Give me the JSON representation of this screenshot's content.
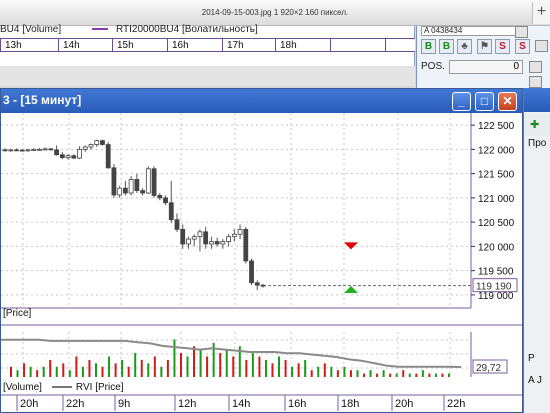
{
  "viewer": {
    "caption": "2014-09-15-003.jpg 1 920×2 160 пиксел.",
    "plus_icon": "plus-icon"
  },
  "bg_chart": {
    "legend_1": "BU4 [Volume]",
    "legend_2": "RTI20000BU4 [Волатильность]",
    "hours": [
      "13h",
      "14h",
      "15h",
      "16h",
      "17h",
      "18h"
    ]
  },
  "trade_panel": {
    "field_value": "A 0438434",
    "buttons": [
      "B",
      "B",
      "S",
      "S"
    ],
    "pos_label": "POS.",
    "pos_value": "0"
  },
  "main_window": {
    "title": "3 - [15 минут]",
    "price_label": "[Price]",
    "bottom_legend_1": "[Volume]",
    "bottom_legend_2": "RVI [Price]"
  },
  "side_window": {
    "text_1": "Про",
    "text_2": "P",
    "text_3": "A  J"
  },
  "chart_data": [
    {
      "type": "candlestick",
      "title": "",
      "y_ticks": [
        "122 500",
        "122 000",
        "121 500",
        "121 000",
        "120 500",
        "120 000",
        "119 500",
        "119 000"
      ],
      "ylim": [
        118750,
        122750
      ],
      "last_price_label": "119 190",
      "last_price": 119190,
      "candles": [
        {
          "o": 121990,
          "h": 122020,
          "l": 121960,
          "c": 121980
        },
        {
          "o": 121980,
          "h": 122010,
          "l": 121950,
          "c": 121990
        },
        {
          "o": 121990,
          "h": 122020,
          "l": 121970,
          "c": 121985
        },
        {
          "o": 121985,
          "h": 122000,
          "l": 121960,
          "c": 121975
        },
        {
          "o": 121975,
          "h": 122010,
          "l": 121950,
          "c": 121990
        },
        {
          "o": 121990,
          "h": 122020,
          "l": 121970,
          "c": 121995
        },
        {
          "o": 121995,
          "h": 122030,
          "l": 121980,
          "c": 122000
        },
        {
          "o": 122000,
          "h": 122040,
          "l": 121980,
          "c": 122010
        },
        {
          "o": 122010,
          "h": 122030,
          "l": 121980,
          "c": 121990
        },
        {
          "o": 121990,
          "h": 122080,
          "l": 121870,
          "c": 121890
        },
        {
          "o": 121890,
          "h": 121950,
          "l": 121800,
          "c": 121830
        },
        {
          "o": 121830,
          "h": 121900,
          "l": 121790,
          "c": 121870
        },
        {
          "o": 121870,
          "h": 121900,
          "l": 121800,
          "c": 121820
        },
        {
          "o": 121820,
          "h": 122060,
          "l": 121800,
          "c": 122000
        },
        {
          "o": 122000,
          "h": 122080,
          "l": 121950,
          "c": 122050
        },
        {
          "o": 122050,
          "h": 122120,
          "l": 121990,
          "c": 122100
        },
        {
          "o": 122100,
          "h": 122200,
          "l": 122050,
          "c": 122180
        },
        {
          "o": 122180,
          "h": 122200,
          "l": 122080,
          "c": 122100
        },
        {
          "o": 122100,
          "h": 122150,
          "l": 121600,
          "c": 121620
        },
        {
          "o": 121620,
          "h": 121700,
          "l": 121000,
          "c": 121060
        },
        {
          "o": 121060,
          "h": 121250,
          "l": 121000,
          "c": 121200
        },
        {
          "o": 121200,
          "h": 121350,
          "l": 121050,
          "c": 121100
        },
        {
          "o": 121100,
          "h": 121450,
          "l": 121050,
          "c": 121380
        },
        {
          "o": 121380,
          "h": 121500,
          "l": 121100,
          "c": 121150
        },
        {
          "o": 121150,
          "h": 121200,
          "l": 121050,
          "c": 121100
        },
        {
          "o": 121100,
          "h": 121650,
          "l": 121080,
          "c": 121600
        },
        {
          "o": 121600,
          "h": 121650,
          "l": 121000,
          "c": 121050
        },
        {
          "o": 121050,
          "h": 121100,
          "l": 120950,
          "c": 121000
        },
        {
          "o": 121000,
          "h": 121050,
          "l": 120850,
          "c": 120900
        },
        {
          "o": 120900,
          "h": 121350,
          "l": 120480,
          "c": 120550
        },
        {
          "o": 120550,
          "h": 120680,
          "l": 120300,
          "c": 120350
        },
        {
          "o": 120350,
          "h": 120450,
          "l": 119950,
          "c": 120050
        },
        {
          "o": 120050,
          "h": 120200,
          "l": 119950,
          "c": 120150
        },
        {
          "o": 120150,
          "h": 120250,
          "l": 120000,
          "c": 120200
        },
        {
          "o": 120200,
          "h": 120350,
          "l": 119900,
          "c": 120300
        },
        {
          "o": 120300,
          "h": 120400,
          "l": 119950,
          "c": 120050
        },
        {
          "o": 120050,
          "h": 120200,
          "l": 119950,
          "c": 120100
        },
        {
          "o": 120100,
          "h": 120180,
          "l": 120000,
          "c": 120050
        },
        {
          "o": 120050,
          "h": 120150,
          "l": 119950,
          "c": 120100
        },
        {
          "o": 120100,
          "h": 120250,
          "l": 120000,
          "c": 120200
        },
        {
          "o": 120200,
          "h": 120350,
          "l": 120100,
          "c": 120250
        },
        {
          "o": 120250,
          "h": 120450,
          "l": 120150,
          "c": 120350
        },
        {
          "o": 120350,
          "h": 120400,
          "l": 119650,
          "c": 119700
        },
        {
          "o": 119700,
          "h": 119750,
          "l": 119200,
          "c": 119250
        },
        {
          "o": 119250,
          "h": 119300,
          "l": 119100,
          "c": 119200
        },
        {
          "o": 119200,
          "h": 119230,
          "l": 119150,
          "c": 119190
        }
      ],
      "markers": [
        {
          "kind": "sell-arrow",
          "y": 120000,
          "color": "#dd0000"
        },
        {
          "kind": "buy-arrow",
          "y": 119120,
          "color": "#1fb41f"
        }
      ]
    },
    {
      "type": "bar",
      "title": "",
      "rvi_label": "29,72",
      "x_ticks": [
        "20h",
        "22h",
        "9h",
        "12h",
        "14h",
        "16h",
        "18h",
        "20h",
        "22h"
      ],
      "volume": [
        3,
        2,
        4,
        3,
        2,
        3,
        5,
        3,
        4,
        2,
        6,
        3,
        5,
        4,
        3,
        6,
        4,
        5,
        3,
        7,
        5,
        4,
        6,
        3,
        5,
        11,
        7,
        6,
        9,
        8,
        6,
        10,
        7,
        8,
        6,
        9,
        5,
        7,
        6,
        5,
        4,
        6,
        5,
        3,
        4,
        5,
        2,
        3,
        4,
        3,
        2,
        3,
        2,
        2,
        1,
        2,
        1,
        2,
        1,
        1,
        2,
        1,
        1,
        2,
        1,
        1,
        1,
        1
      ],
      "volume_colors": [
        "red",
        "green"
      ],
      "rvi": [
        74,
        74,
        74,
        74,
        72,
        72,
        72,
        72,
        72,
        72,
        72,
        70,
        68,
        64,
        62,
        60,
        58,
        60,
        58,
        56,
        54,
        54,
        54,
        52,
        52,
        50,
        48,
        46,
        42,
        40,
        36,
        32,
        30,
        30,
        30,
        30,
        30,
        29.72
      ]
    }
  ]
}
